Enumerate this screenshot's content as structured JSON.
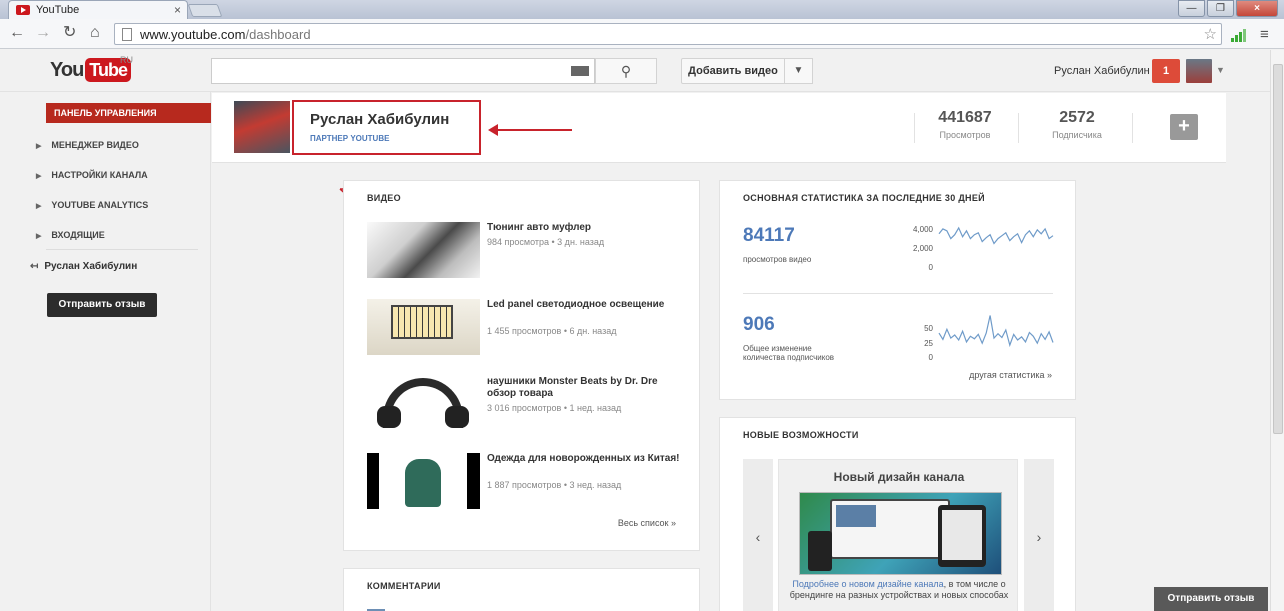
{
  "browser": {
    "tab_title": "YouTube",
    "tab_close": "×",
    "url_host": "www.youtube.com",
    "url_path": "/dashboard",
    "window_buttons": [
      "—",
      "❐",
      "×"
    ]
  },
  "masthead": {
    "logo_you": "You",
    "logo_tube": "Tube",
    "logo_region": "RU",
    "search_value": "",
    "upload_label": "Добавить видео",
    "user_name": "Руслан Хабибулин",
    "notification_count": "1"
  },
  "sidebar": {
    "active_item": "ПАНЕЛЬ УПРАВЛЕНИЯ",
    "items": [
      {
        "label": "МЕНЕДЖЕР ВИДЕО"
      },
      {
        "label": "НАСТРОЙКИ КАНАЛА"
      },
      {
        "label": "YOUTUBE ANALYTICS"
      },
      {
        "label": "ВХОДЯЩИЕ"
      }
    ],
    "user_link": "Руслан Хабибулин",
    "feedback_button": "Отправить отзыв"
  },
  "channel": {
    "name": "Руслан Хабибулин",
    "badge": "ПАРТНЕР YOUTUBE",
    "views_value": "441687",
    "views_label": "Просмотров",
    "subs_value": "2572",
    "subs_label": "Подписчика"
  },
  "videos_card": {
    "title": "ВИДЕО",
    "items": [
      {
        "title": "Тюнинг авто муфлер",
        "meta": "984 просмотра  •  3 дн. назад"
      },
      {
        "title": "Led panel светодиодное освещение",
        "meta": "1 455 просмотров  •  6 дн. назад"
      },
      {
        "title": "наушники Monster Beats by Dr. Dre обзор товара",
        "meta": "3 016 просмотров  •  1 нед. назад"
      },
      {
        "title": "Одежда для новорожденных из Китая!",
        "meta": "1 887 просмотров  •  3 нед. назад"
      }
    ],
    "see_all": "Весь список  »"
  },
  "comments_card": {
    "title": "КОММЕНТАРИИ"
  },
  "stats_card": {
    "title": "ОСНОВНАЯ СТАТИСТИКА ЗА ПОСЛЕДНИЕ 30 ДНЕЙ",
    "views_value": "84117",
    "views_label": "просмотров видео",
    "views_axis": [
      "4,000",
      "2,000",
      "0"
    ],
    "views_series": [
      3400,
      3900,
      3700,
      2900,
      3300,
      4000,
      3100,
      3700,
      2900,
      3300,
      3500,
      2600,
      3000,
      3300,
      2400,
      2900,
      3200,
      3500,
      2700,
      3100,
      3400,
      2500,
      3300,
      3700,
      3100,
      3800,
      3400,
      3900,
      2900,
      3200
    ],
    "subs_value": "906",
    "subs_label_1": "Общее изменение",
    "subs_label_2": "количества подписчиков",
    "subs_axis": [
      "50",
      "25",
      "0"
    ],
    "subs_series": [
      38,
      28,
      44,
      30,
      35,
      27,
      41,
      24,
      33,
      29,
      36,
      22,
      38,
      66,
      30,
      37,
      31,
      43,
      19,
      36,
      27,
      32,
      24,
      39,
      33,
      22,
      37,
      28,
      40,
      23
    ],
    "more_link": "другая статистика  »"
  },
  "features_card": {
    "title": "НОВЫЕ ВОЗМОЖНОСТИ",
    "feature_title": "Новый дизайн канала",
    "link_text": "Подробнее о новом дизайне канала",
    "text_rest": ", в том числе о брендинге на разных устройствах и новых способах",
    "prev": "‹",
    "next": "›"
  },
  "floating_feedback": "Отправить отзыв",
  "colors": {
    "accent_red": "#b7291e",
    "link_blue": "#4d79b8",
    "annotation_red": "#c8232c"
  }
}
